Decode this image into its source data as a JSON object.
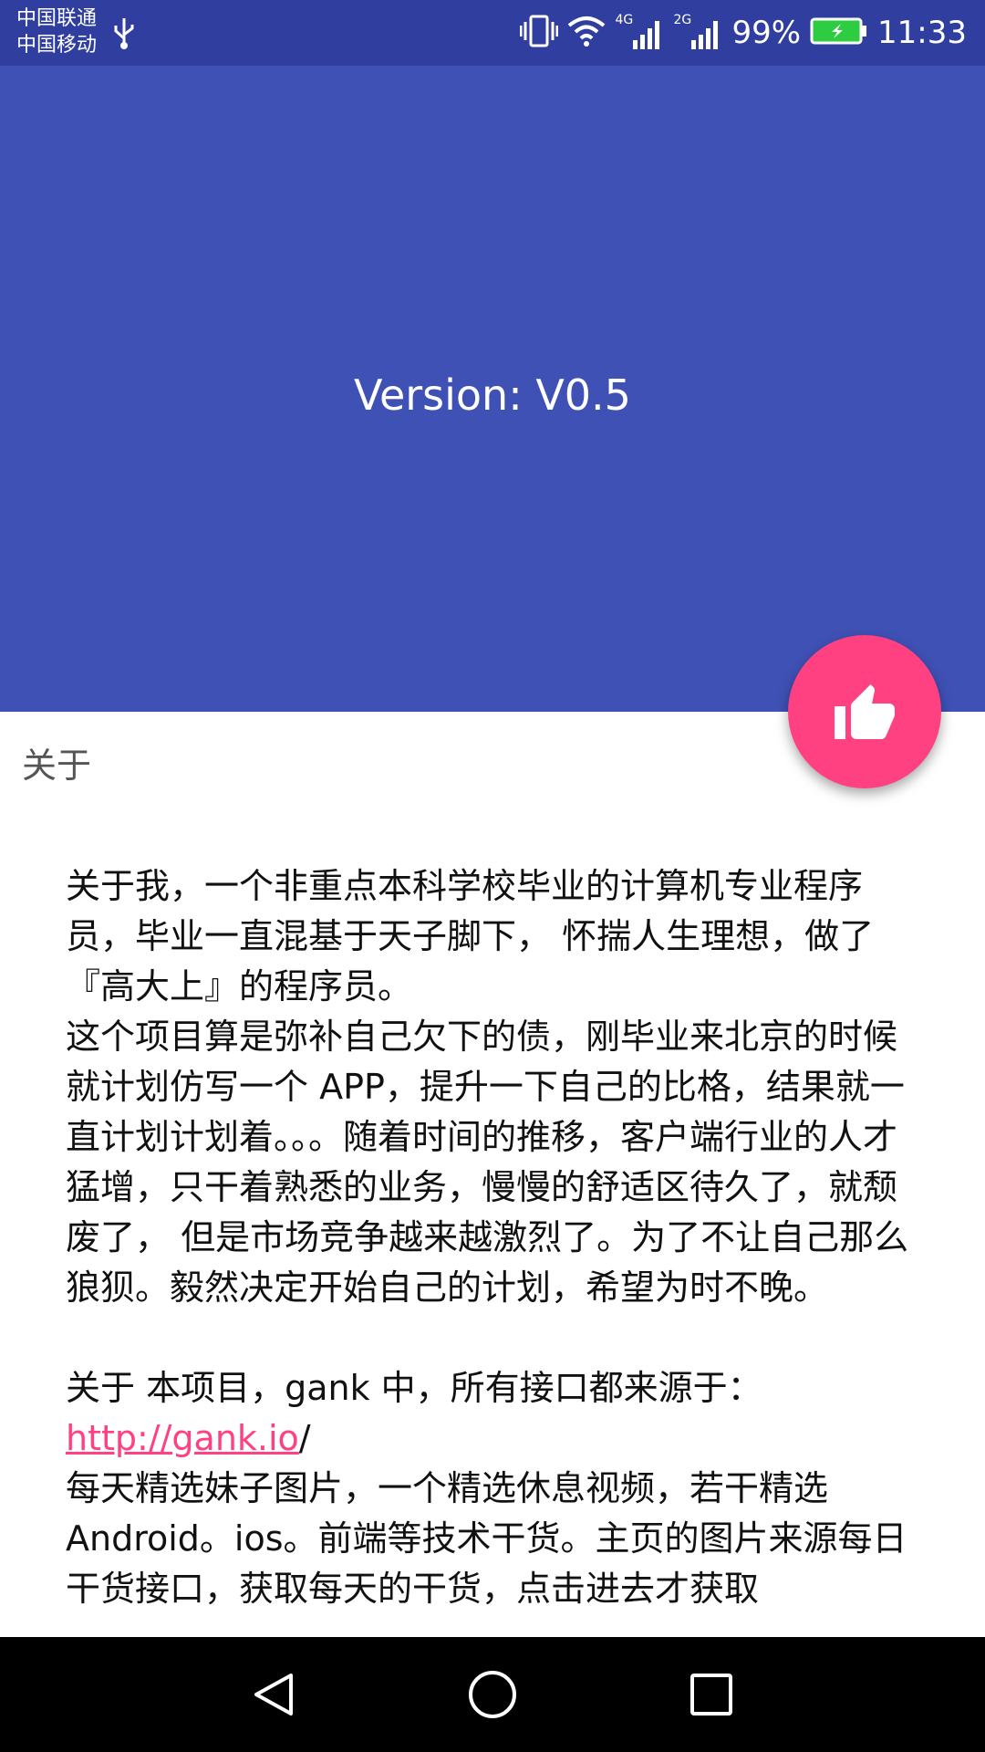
{
  "status_bar": {
    "carrier1": "中国联通",
    "carrier2": "中国移动",
    "signal1_label": "4G",
    "signal2_label": "2G",
    "battery": "99%",
    "time": "11:33",
    "icons": [
      "usb-icon",
      "vibrate-icon",
      "wifi-icon",
      "signal-icon",
      "battery-icon"
    ]
  },
  "header": {
    "version": "Version: V0.5",
    "color": "#3F51B5"
  },
  "fab": {
    "icon": "thumb-up-icon",
    "color": "#FF4081"
  },
  "section": {
    "title": "关于"
  },
  "about": {
    "p1": "关于我，一个非重点本科学校毕业的计算机专业程序员，毕业一直混基于天子脚下， 怀揣人生理想，做了『高大上』的程序员。",
    "p2": "这个项目算是弥补自己欠下的债，刚毕业来北京的时候就计划仿写一个 APP，提升一下自己的比格，结果就一直计划计划着。。。随着时间的推移，客户端行业的人才猛增，只干着熟悉的业务，慢慢的舒适区待久了，就颓废了， 但是市场竞争越来越激烈了。为了不让自己那么狼狈。毅然决定开始自己的计划，希望为时不晚。",
    "p3": "关于 本项目，gank 中，所有接口都来源于：",
    "link": "http://gank.io",
    "link_suffix": "/",
    "p4": "每天精选妹子图片，一个精选休息视频，若干精选Android。ios。前端等技术干货。主页的图片来源每日干货接口，获取每天的干货，点击进去才获取"
  },
  "nav": {
    "buttons": [
      "back-icon",
      "home-icon",
      "recents-icon"
    ]
  }
}
